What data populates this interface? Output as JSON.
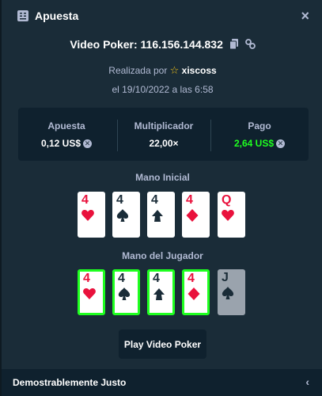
{
  "header": {
    "title": "Apuesta",
    "close_label": "×"
  },
  "game": {
    "title": "Video Poker: 116.156.144.832"
  },
  "made_by": {
    "prefix": "Realizada por",
    "user": "xiscoss"
  },
  "date": "el 19/10/2022 a las 6:58",
  "stats": {
    "bet": {
      "label": "Apuesta",
      "value": "0,12 US$"
    },
    "multiplier": {
      "label": "Multiplicador",
      "value": "22,00×"
    },
    "payout": {
      "label": "Pago",
      "value": "2,64 US$"
    }
  },
  "initial_hand": {
    "label": "Mano Inicial",
    "cards": [
      {
        "rank": "4",
        "suit": "hearts"
      },
      {
        "rank": "4",
        "suit": "spades"
      },
      {
        "rank": "4",
        "suit": "clubs"
      },
      {
        "rank": "4",
        "suit": "diamonds"
      },
      {
        "rank": "Q",
        "suit": "hearts"
      }
    ]
  },
  "player_hand": {
    "label": "Mano del Jugador",
    "cards": [
      {
        "rank": "4",
        "suit": "hearts",
        "held": true
      },
      {
        "rank": "4",
        "suit": "spades",
        "held": true
      },
      {
        "rank": "4",
        "suit": "clubs",
        "held": true
      },
      {
        "rank": "4",
        "suit": "diamonds",
        "held": true
      },
      {
        "rank": "J",
        "suit": "spades",
        "held": false
      }
    ]
  },
  "play_button": "Play Video Poker",
  "footer": {
    "label": "Demostrablemente Justo"
  },
  "colors": {
    "payout_green": "#1fff20",
    "held_border": "#1fff20",
    "red_suit": "#e9113c",
    "dark_suit": "#1a2c38"
  }
}
